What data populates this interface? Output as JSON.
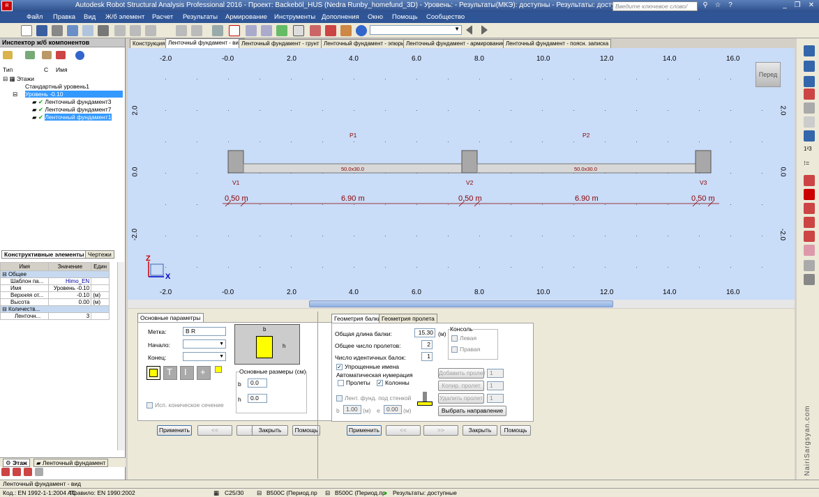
{
  "window": {
    "title": "Autodesk Robot Structural Analysis Professional 2016 - Проект: Backeböl_HUS (Nedra Runby_homefund_3D) - Уровень:  - Результаты(МКЭ): доступны - Результаты: доступные",
    "search_placeholder": "Введите ключевое слово/фразу"
  },
  "menu": [
    "Файл",
    "Правка",
    "Вид",
    "Ж/б элемент",
    "Расчет",
    "Результаты",
    "Армирование",
    "Инструменты",
    "Дополнения",
    "Окно",
    "Помощь",
    "Сообщество"
  ],
  "inspector": {
    "title": "Инспектор ж/б компонентов",
    "col_type": "Тип",
    "col_c": "С",
    "col_name": "Имя",
    "tree": [
      "Этажи",
      "Стандартный уровень1",
      "Уровень -0.10",
      "Ленточный фундамент3",
      "Ленточный фундамент7",
      "Ленточный фундамент1"
    ],
    "tab_elements": "Конструктивные элементы",
    "tab_drawings": "Чертежи",
    "props": {
      "h_name": "Имя",
      "h_value": "Значение",
      "h_unit": "Един",
      "group1": "Общее",
      "rows": [
        [
          "Шаблон па...",
          "Himo_EN",
          ""
        ],
        [
          "Имя",
          "Уровень -0.10",
          ""
        ],
        [
          "Верхняя от...",
          "-0.10",
          "(м)"
        ],
        [
          "Высота",
          "0.00",
          "(м)"
        ]
      ],
      "group2": "Количеств...",
      "rows2": [
        [
          "Ленточн...",
          "3",
          ""
        ]
      ]
    },
    "tab_floor": "Этаж",
    "tab_strip": "Ленточный фундамент"
  },
  "view_tabs": [
    "Конструкция",
    "Ленточный фундамент - вид",
    "Ленточный фундамент - грунт",
    "Ленточный фундамент - эпюры",
    "Ленточный фундамент - армирование",
    "Ленточный фундамент - поясн. записка"
  ],
  "view": {
    "xticks": [
      "-2.0",
      "-0.0",
      "2.0",
      "4.0",
      "6.0",
      "8.0",
      "10.0",
      "12.0",
      "14.0",
      "16.0"
    ],
    "yticks": [
      "2.0",
      "0.0",
      "-2.0"
    ],
    "spans": [
      "P1",
      "P2"
    ],
    "section": "50.0x30.0",
    "supports": [
      "V1",
      "V2",
      "V3"
    ],
    "dims": [
      "0.50 m",
      "6.90 m",
      "0.50 m",
      "6.90 m",
      "0.50 m"
    ],
    "viewcube": "Перед",
    "axis_z": "Z",
    "axis_x": "X"
  },
  "left_dialog": {
    "tab": "Основные параметры",
    "label_mark": "Метка:",
    "mark": "B R",
    "label_start": "Начало:",
    "label_end": "Конец:",
    "dims_title": "Основные размеры (см)",
    "b_label": "b",
    "b": "0.0",
    "h_label": "h",
    "h": "0.0",
    "conical": "Исп. коническое сечение",
    "fig_b": "b",
    "fig_h": "h",
    "buttons": [
      "Применить",
      "<<",
      ">>",
      "Закрыть",
      "Помощь"
    ]
  },
  "right_dialog": {
    "tab1": "Геометрия балки",
    "tab2": "Геометрия пролета",
    "total_len_label": "Общая длина балки:",
    "total_len": "15.30",
    "unit_m": "(м)",
    "spans_label": "Общее число пролетов:",
    "spans": "2",
    "ident_label": "Число идентичных балок:",
    "ident": "1",
    "simplified": "Упрощенные имена",
    "auto_num": "Автоматическая нумерация",
    "chk_spans": "Пролеты",
    "chk_cols": "Колонны",
    "console": "Консоль",
    "left": "Левая",
    "right": "Правая",
    "wall": "Лент. фунд. под стенкой",
    "wb": "b",
    "wb_val": "1.00",
    "we": "e",
    "we_val": "0.00",
    "add_span": "Добавить пролет",
    "copy_span": "Копир. пролет",
    "del_span": "Удалить пролет",
    "select_dir": "Выбрать направление",
    "spin": "1",
    "buttons": [
      "Применить",
      "<<",
      ">>",
      "Закрыть",
      "Помощь"
    ]
  },
  "status_view": "Ленточный фундамент - вид",
  "status": {
    "code": "Код.: EN 1992-1-1:2004 AC",
    "rule": "Правило: EN 1990:2002",
    "concrete": "C25/30",
    "steel1": "B500C (Период.пр",
    "steel2": "B500C (Период.пр",
    "results": "Результаты: доступные"
  },
  "watermark": "© NairiSargsyan.com",
  "colors": {
    "view_bg": "#c9dcf8",
    "title_bg": "#2d4f8c",
    "selection": "#3399ff",
    "label_red": "#8b0000"
  }
}
